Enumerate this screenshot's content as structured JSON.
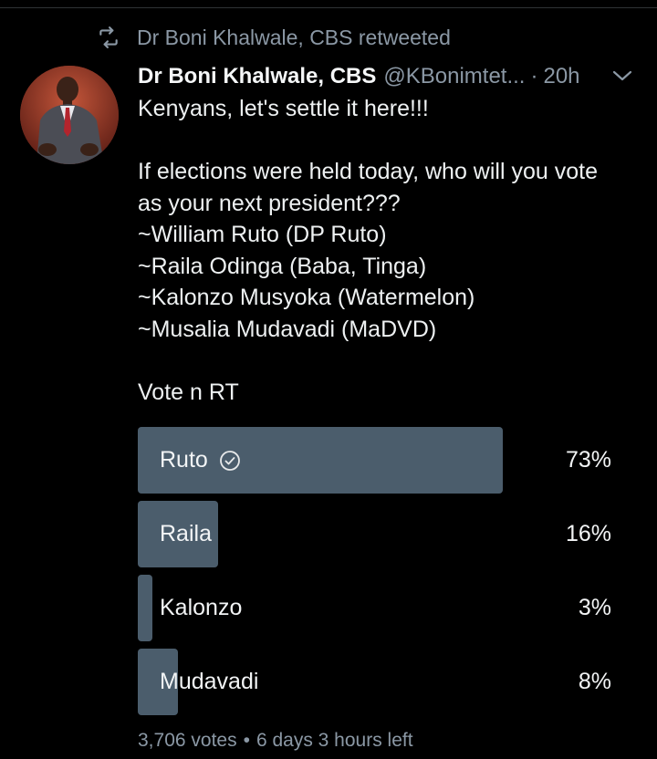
{
  "retweet": {
    "icon": "retweet-icon",
    "text": "Dr Boni Khalwale, CBS retweeted"
  },
  "tweet": {
    "author_name": "Dr Boni Khalwale, CBS",
    "handle": "@KBonimtet...",
    "separator": "·",
    "time": "20h",
    "lines": [
      "Kenyans, let's settle it here!!!",
      "",
      "If elections were held today, who will you vote",
      "as your next president???",
      "~William Ruto (DP Ruto)",
      "~Raila Odinga (Baba, Tinga)",
      "~Kalonzo Musyoka (Watermelon)",
      "~Musalia Mudavadi (MaDVD)",
      "",
      "Vote n RT"
    ]
  },
  "poll": {
    "bar_color": "#4b5d6c",
    "options": [
      {
        "label": "Ruto",
        "percent_text": "73%",
        "fraction": 0.73,
        "selected": true
      },
      {
        "label": "Raila",
        "percent_text": "16%",
        "fraction": 0.16,
        "selected": false
      },
      {
        "label": "Kalonzo",
        "percent_text": "3%",
        "fraction": 0.03,
        "selected": false
      },
      {
        "label": "Mudavadi",
        "percent_text": "8%",
        "fraction": 0.08,
        "selected": false
      }
    ],
    "votes_text": "3,706 votes",
    "dot": "•",
    "time_left_text": "6 days 3 hours left"
  },
  "colors": {
    "background": "#000000",
    "secondary_text": "#8b98a5",
    "primary_text": "#e7e9ea"
  }
}
